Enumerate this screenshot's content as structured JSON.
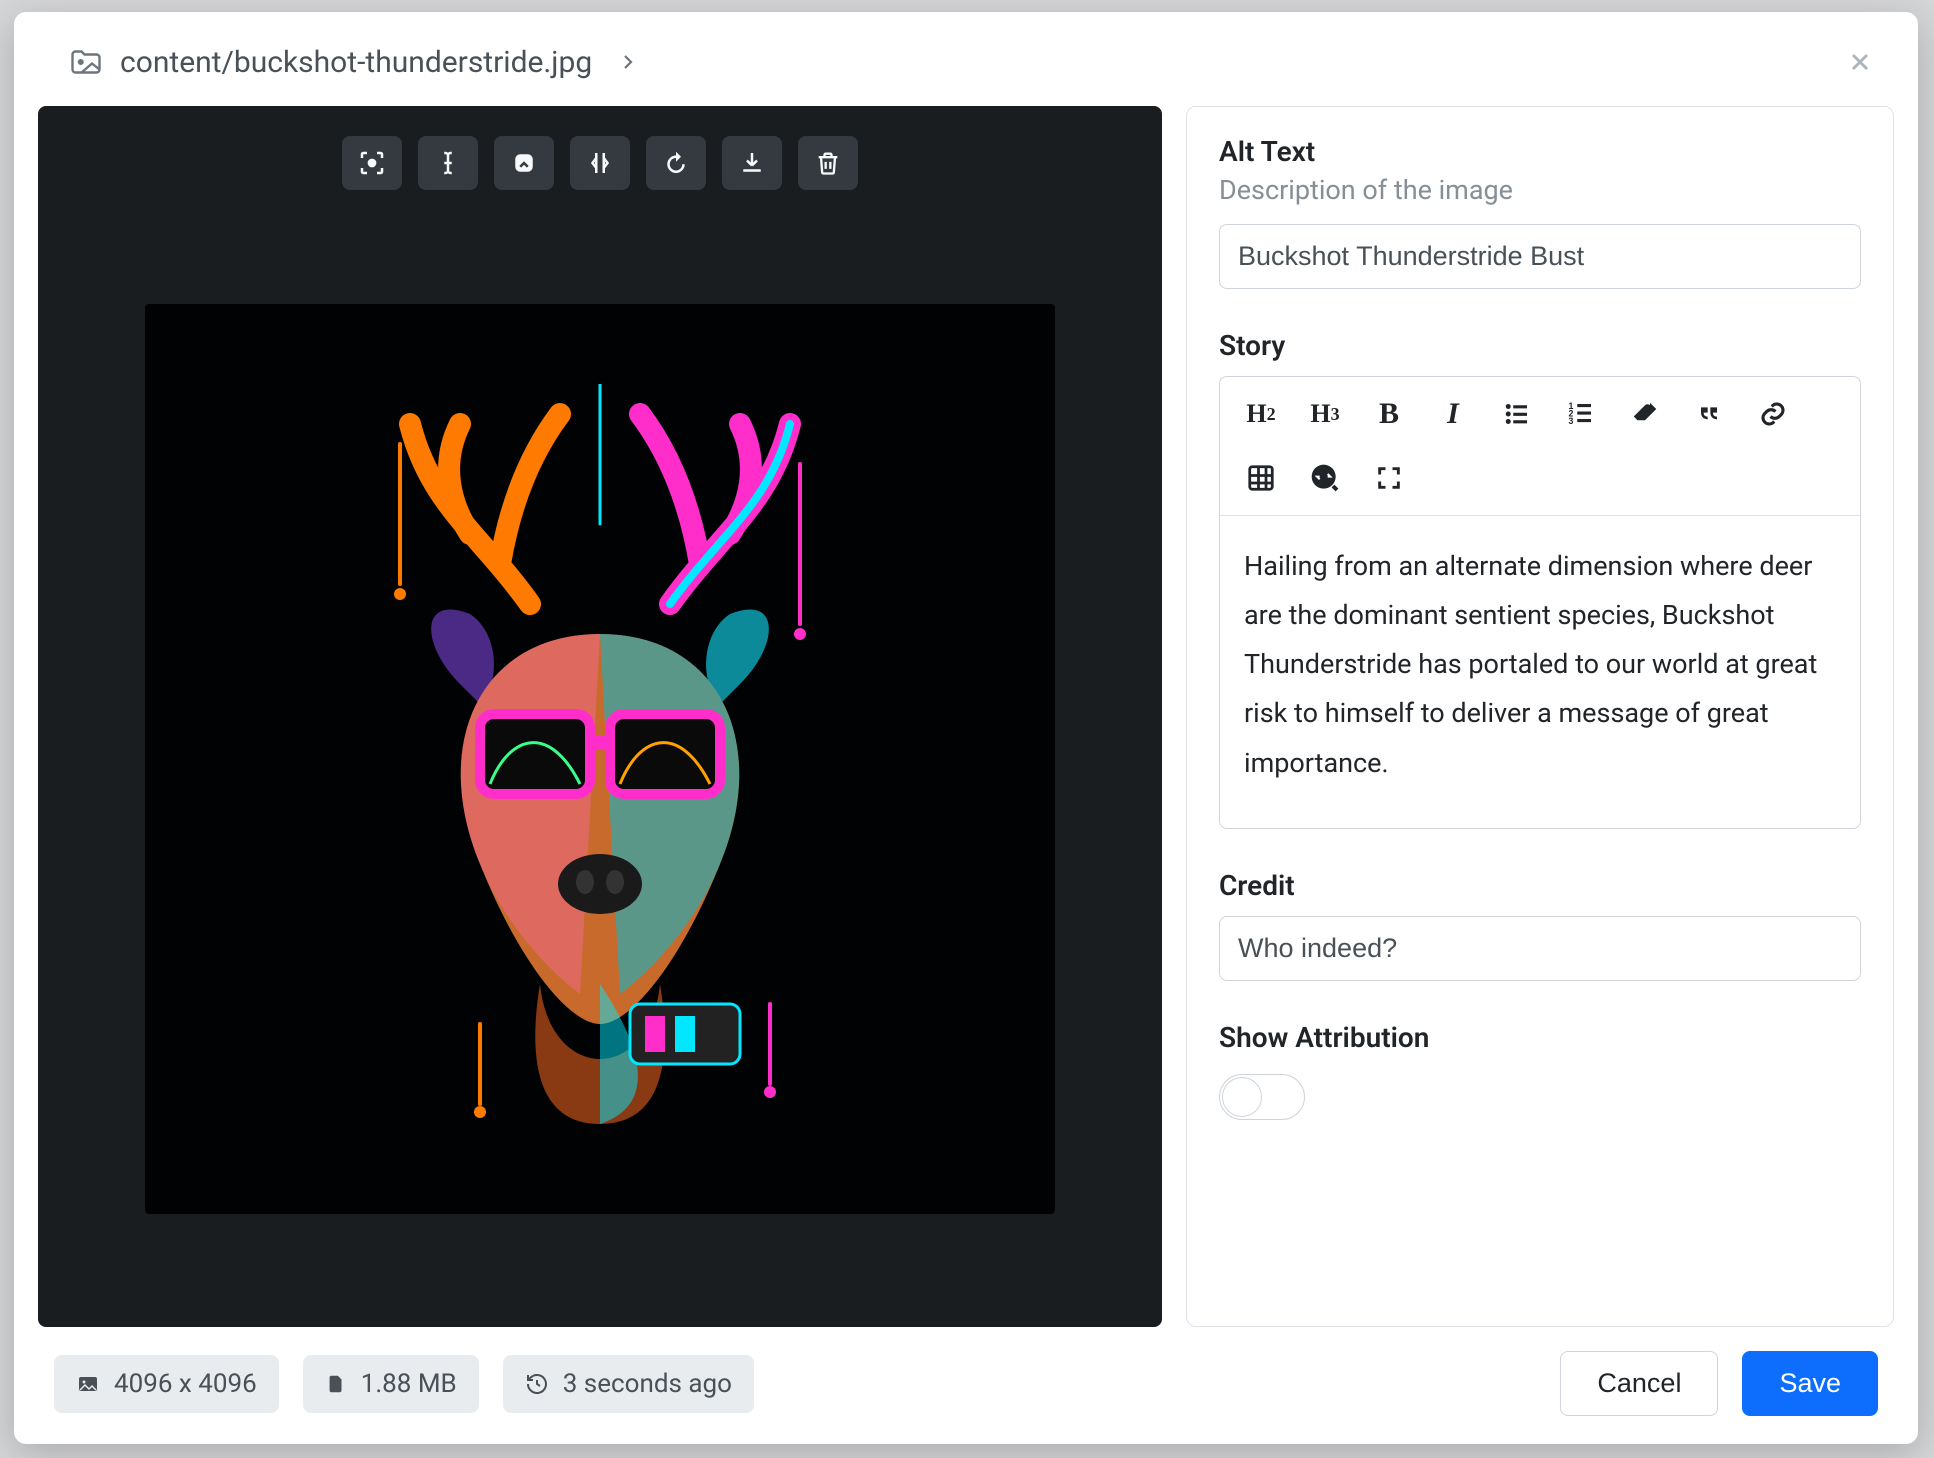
{
  "header": {
    "path": "content/buckshot-thunderstride.jpg"
  },
  "form": {
    "alt_text": {
      "label": "Alt Text",
      "sub": "Description of the image",
      "value": "Buckshot Thunderstride Bust"
    },
    "story": {
      "label": "Story",
      "content": "Hailing from an alternate dimension where deer are the dominant sentient species, Buckshot Thunderstride has portaled to our world at great risk to himself to deliver a message of great importance."
    },
    "credit": {
      "label": "Credit",
      "value": "Who indeed?"
    },
    "attribution": {
      "label": "Show Attribution",
      "enabled": false
    }
  },
  "meta": {
    "dimensions": "4096 x 4096",
    "filesize": "1.88 MB",
    "updated": "3 seconds ago"
  },
  "actions": {
    "cancel": "Cancel",
    "save": "Save"
  },
  "editor_icons": [
    "h2",
    "h3",
    "bold",
    "italic",
    "ul",
    "ol",
    "eraser",
    "quote",
    "link",
    "table",
    "code-search",
    "expand"
  ],
  "preview_tools": [
    "focal-point",
    "alt-text",
    "crop",
    "flip",
    "rotate",
    "download",
    "delete"
  ]
}
